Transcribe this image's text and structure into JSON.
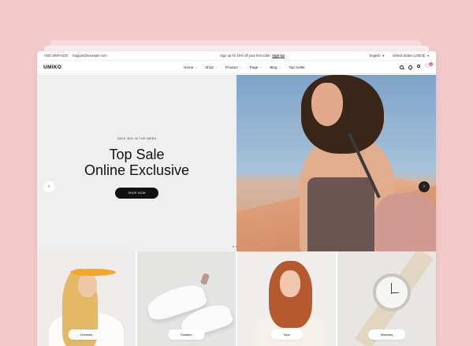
{
  "topbar": {
    "phone": "+333-1900-0430",
    "email": "Support@example.com",
    "promo_text": "Sign up for 10% off your first order:",
    "promo_link": "Sign Up",
    "language": "English",
    "region": "United States (USD $)"
  },
  "header": {
    "logo": "UMIKO",
    "nav": [
      {
        "label": "Home"
      },
      {
        "label": "Shop"
      },
      {
        "label": "Product"
      },
      {
        "label": "Page"
      },
      {
        "label": "Blog"
      },
      {
        "label": "Top Seller"
      }
    ],
    "wishlist_count": "0",
    "cart_count": "0"
  },
  "hero": {
    "eyebrow": "SAVE 30% IN THE WEEK",
    "title_line1": "Top Sale",
    "title_line2": "Online Exclusive",
    "cta": "SHOP NOW"
  },
  "categories": [
    {
      "label": "Dresses"
    },
    {
      "label": "Sneaker"
    },
    {
      "label": "Tops"
    },
    {
      "label": "Watches"
    }
  ],
  "colors": {
    "background": "#f3c9ca",
    "accent": "#111111",
    "badge": "#e75f8f"
  }
}
